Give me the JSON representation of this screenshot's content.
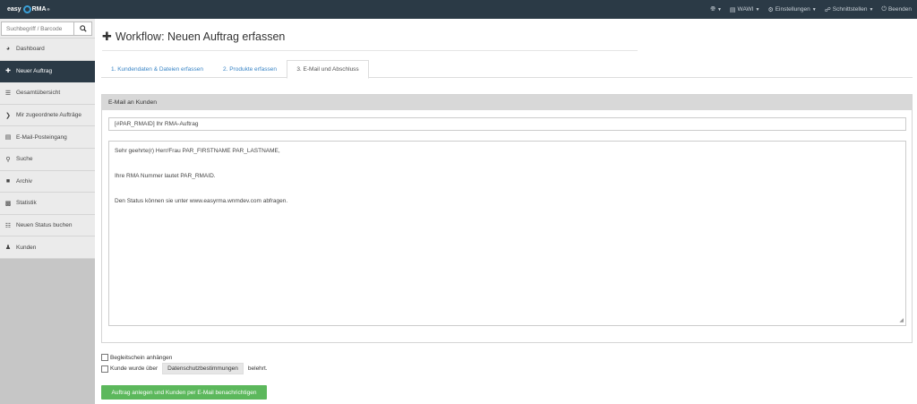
{
  "brand": {
    "part1": "easy",
    "part2": "RMA",
    "mark": "®"
  },
  "navbar": {
    "items": [
      {
        "icon": "globe-icon",
        "label": ""
      },
      {
        "icon": "box-icon",
        "label": "WAWI"
      },
      {
        "icon": "gear-icon",
        "label": "Einstellungen"
      },
      {
        "icon": "plug-icon",
        "label": "Schnittstellen"
      },
      {
        "icon": "power-icon",
        "label": "Beenden"
      }
    ]
  },
  "sidebar": {
    "search_placeholder": "Suchbegriff / Barcode",
    "items": [
      {
        "label": "Dashboard",
        "icon": "dashboard-icon"
      },
      {
        "label": "Neuer Auftrag",
        "icon": "plus-icon",
        "active": true
      },
      {
        "label": "Gesamtübersicht",
        "icon": "list-icon"
      },
      {
        "label": "Mir zugeordnete Aufträge",
        "icon": "chevron-right-icon"
      },
      {
        "label": "E-Mail-Posteingang",
        "icon": "inbox-icon"
      },
      {
        "label": "Suche",
        "icon": "search-icon"
      },
      {
        "label": "Archiv",
        "icon": "archive-icon"
      },
      {
        "label": "Statistik",
        "icon": "chart-icon"
      },
      {
        "label": "Neuen Status buchen",
        "icon": "list-alt-icon"
      },
      {
        "label": "Kunden",
        "icon": "users-icon"
      }
    ]
  },
  "main": {
    "title": "Workflow: Neuen Auftrag erfassen",
    "tabs": [
      {
        "label": "1. Kundendaten & Dateien erfassen"
      },
      {
        "label": "2. Produkte erfassen"
      },
      {
        "label": "3. E-Mail und Abschluss",
        "active": true
      }
    ],
    "panel_title": "E-Mail an Kunden",
    "subject": "[#PAR_RMAID] Ihr RMA-Auftrag",
    "body_lines": [
      "Sehr geehrte(r) Herr/Frau PAR_FIRSTNAME PAR_LASTNAME,",
      "",
      "Ihre RMA Nummer lautet PAR_RMAID.",
      "",
      "Den Status können sie unter www.easyrma.wnmdev.com abfragen."
    ],
    "checkbox1_label": "Begleitschein anhängen",
    "checkbox2_prefix": "Kunde wurde über",
    "checkbox2_button": "Datenschutzbestimmungen",
    "checkbox2_suffix": "belehrt.",
    "submit_label": "Auftrag anlegen und Kunden per E-Mail benachrichtigen"
  },
  "colors": {
    "navbar": "#2b3a46",
    "active_tab": "#2b3a46",
    "link": "#3a85c6",
    "submit": "#5cb85c"
  }
}
